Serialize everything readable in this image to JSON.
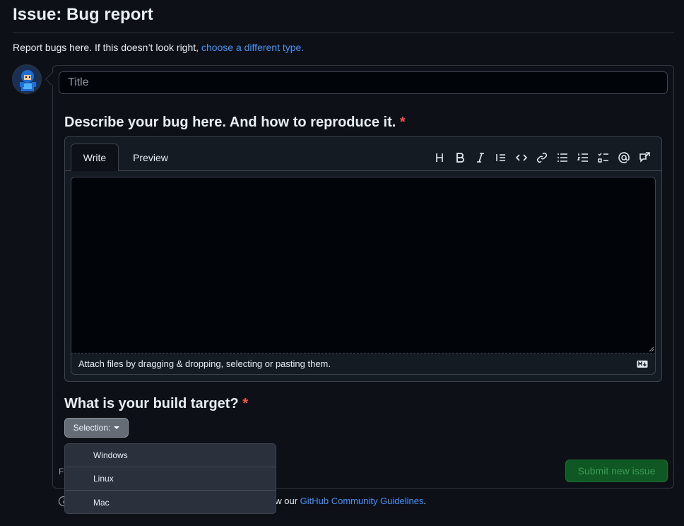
{
  "header": {
    "title": "Issue: Bug report",
    "subtitle_text": "Report bugs here. If this doesn’t look right, ",
    "subtitle_link": "choose a different type."
  },
  "form": {
    "title_placeholder": "Title",
    "description_label": "Describe your bug here. And how to reproduce it.",
    "required_marker": "*",
    "editor": {
      "tabs": [
        "Write",
        "Preview"
      ],
      "toolbar_icons": [
        "heading-icon",
        "bold-icon",
        "italic-icon",
        "quote-icon",
        "code-icon",
        "link-icon",
        "unordered-list-icon",
        "ordered-list-icon",
        "task-list-icon",
        "mention-icon",
        "cross-reference-icon"
      ],
      "attach_text": "Attach files by dragging & dropping, selecting or pasting them."
    },
    "build_target_label": "What is your build target?",
    "select_label": "Selection:",
    "menu_options": [
      "Windows",
      "Linux",
      "Mac"
    ],
    "partial_left_text": "Fi",
    "submit_label": "Submit new issue"
  },
  "footer": {
    "text_visible": "ow our ",
    "link": "GitHub Community Guidelines",
    "period": "."
  },
  "colors": {
    "background": "#0d1117",
    "accent_link": "#4493f8",
    "required": "#f85149",
    "submit_bg": "#105823"
  }
}
